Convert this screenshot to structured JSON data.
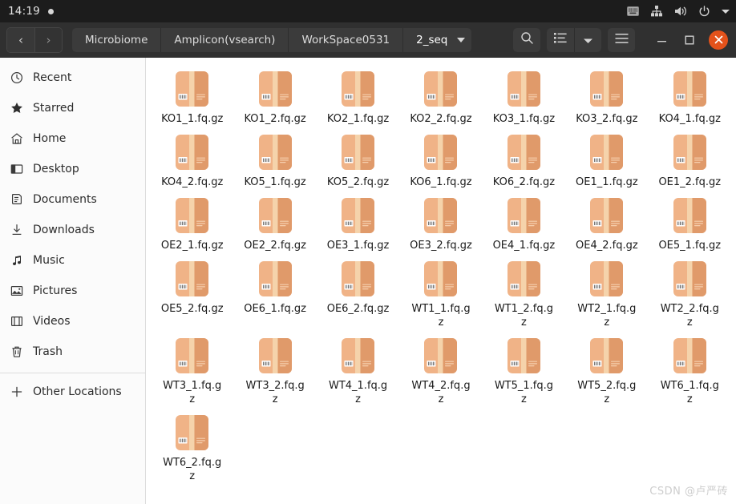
{
  "topbar": {
    "clock": "14:19",
    "indicator_icon": "recording-dot-icon",
    "tray": [
      {
        "name": "keyboard-layout-icon",
        "label": "keyboard"
      },
      {
        "name": "network-icon",
        "label": "network"
      },
      {
        "name": "volume-icon",
        "label": "volume"
      },
      {
        "name": "power-icon",
        "label": "power"
      },
      {
        "name": "chevron-down-icon",
        "label": "menu"
      }
    ]
  },
  "header": {
    "back_label": "‹",
    "forward_label": "›",
    "breadcrumbs": [
      {
        "label": "Microbiome",
        "current": false
      },
      {
        "label": "Amplicon(vsearch)",
        "current": false
      },
      {
        "label": "WorkSpace0531",
        "current": false
      },
      {
        "label": "2_seq",
        "current": true
      }
    ],
    "search_icon": "search-icon",
    "view_list_icon": "list-view-icon",
    "view_dropdown_icon": "chevron-down-icon",
    "menu_icon": "hamburger-menu-icon",
    "minimize_label": "—",
    "maximize_label": "□",
    "close_label": "✕",
    "close_color": "#e4521b"
  },
  "sidebar": {
    "items": [
      {
        "label": "Recent",
        "icon": "clock-icon"
      },
      {
        "label": "Starred",
        "icon": "star-icon"
      },
      {
        "label": "Home",
        "icon": "home-icon"
      },
      {
        "label": "Desktop",
        "icon": "desktop-icon"
      },
      {
        "label": "Documents",
        "icon": "documents-icon"
      },
      {
        "label": "Downloads",
        "icon": "download-icon"
      },
      {
        "label": "Music",
        "icon": "music-note-icon"
      },
      {
        "label": "Pictures",
        "icon": "pictures-icon"
      },
      {
        "label": "Videos",
        "icon": "videos-icon"
      },
      {
        "label": "Trash",
        "icon": "trash-icon"
      }
    ],
    "other_locations": {
      "label": "Other Locations",
      "icon": "plus-icon"
    }
  },
  "content": {
    "file_icon_name": "archive-file-icon",
    "icon_colors": {
      "box_light": "#f0b387",
      "box_dark": "#e09a6a",
      "stripe": "#f5d3ab",
      "label": "#ffffff"
    },
    "files": [
      "KO1_1.fq.gz",
      "KO1_2.fq.gz",
      "KO2_1.fq.gz",
      "KO2_2.fq.gz",
      "KO3_1.fq.gz",
      "KO3_2.fq.gz",
      "KO4_1.fq.gz",
      "KO4_2.fq.gz",
      "KO5_1.fq.gz",
      "KO5_2.fq.gz",
      "KO6_1.fq.gz",
      "KO6_2.fq.gz",
      "OE1_1.fq.gz",
      "OE1_2.fq.gz",
      "OE2_1.fq.gz",
      "OE2_2.fq.gz",
      "OE3_1.fq.gz",
      "OE3_2.fq.gz",
      "OE4_1.fq.gz",
      "OE4_2.fq.gz",
      "OE5_1.fq.gz",
      "OE5_2.fq.gz",
      "OE6_1.fq.gz",
      "OE6_2.fq.gz",
      "WT1_1.fq.gz",
      "WT1_2.fq.gz",
      "WT2_1.fq.gz",
      "WT2_2.fq.gz",
      "WT3_1.fq.gz",
      "WT3_2.fq.gz",
      "WT4_1.fq.gz",
      "WT4_2.fq.gz",
      "WT5_1.fq.gz",
      "WT5_2.fq.gz",
      "WT6_1.fq.gz",
      "WT6_2.fq.gz"
    ]
  },
  "watermark": {
    "text": "CSDN @卢严砖"
  }
}
